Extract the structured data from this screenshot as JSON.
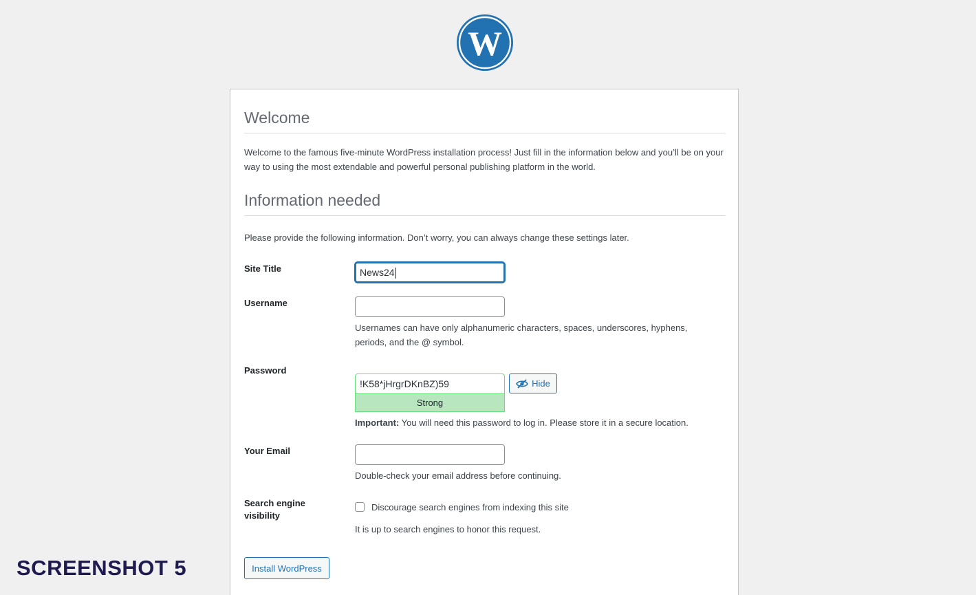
{
  "logo": {
    "name": "wordpress-logo",
    "color": "#2271b1"
  },
  "welcome": {
    "heading": "Welcome",
    "text": "Welcome to the famous five-minute WordPress installation process! Just fill in the information below and you’ll be on your way to using the most extendable and powerful personal publishing platform in the world."
  },
  "info": {
    "heading": "Information needed",
    "text": "Please provide the following information. Don’t worry, you can always change these settings later."
  },
  "form": {
    "site_title": {
      "label": "Site Title",
      "value": "News24"
    },
    "username": {
      "label": "Username",
      "value": "",
      "hint": "Usernames can have only alphanumeric characters, spaces, underscores, hyphens, periods, and the @ symbol."
    },
    "password": {
      "label": "Password",
      "value": "!K58*jHrgrDKnBZ)59",
      "strength": "Strong",
      "hide_label": "Hide",
      "important_label": "Important:",
      "important_text": " You will need this password to log in. Please store it in a secure location."
    },
    "email": {
      "label": "Your Email",
      "value": "",
      "hint": "Double-check your email address before continuing."
    },
    "search_engine": {
      "label_line1": "Search engine",
      "label_line2": "visibility",
      "checkbox_label": "Discourage search engines from indexing this site",
      "checked": false,
      "hint": "It is up to search engines to honor this request."
    }
  },
  "install_button": "Install WordPress",
  "watermark": "SCREENSHOT 5"
}
